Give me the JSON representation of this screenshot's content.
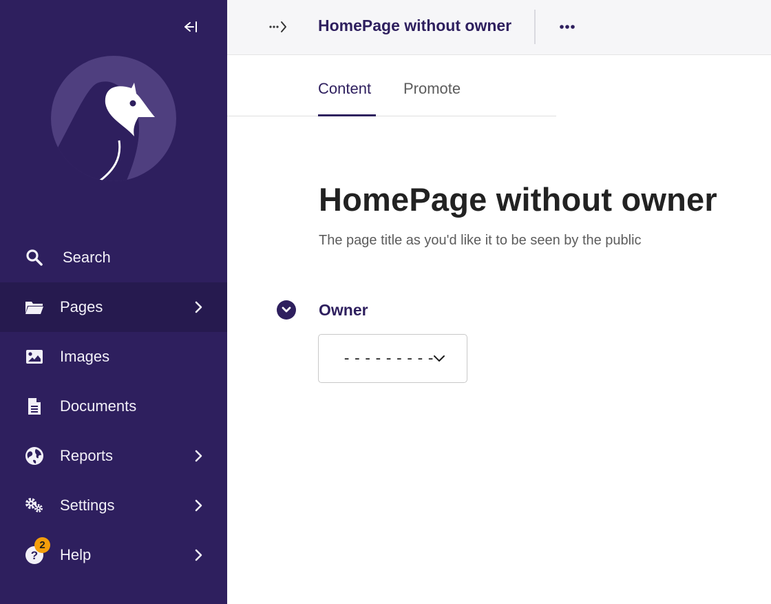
{
  "sidebar": {
    "items": [
      {
        "label": "Search",
        "icon": "search-icon"
      },
      {
        "label": "Pages",
        "icon": "folder-open-icon",
        "has_submenu": true,
        "active": true
      },
      {
        "label": "Images",
        "icon": "image-icon"
      },
      {
        "label": "Documents",
        "icon": "document-icon"
      },
      {
        "label": "Reports",
        "icon": "globe-icon",
        "has_submenu": true
      },
      {
        "label": "Settings",
        "icon": "cogs-icon",
        "has_submenu": true
      },
      {
        "label": "Help",
        "icon": "help-icon",
        "has_submenu": true,
        "badge": "2"
      }
    ]
  },
  "header": {
    "title": "HomePage without owner"
  },
  "tabs": [
    {
      "label": "Content",
      "active": true
    },
    {
      "label": "Promote",
      "active": false
    }
  ],
  "main": {
    "title": "HomePage without owner",
    "title_help": "The page title as you'd like it to be seen by the public",
    "owner": {
      "label": "Owner",
      "selected": "---------"
    }
  },
  "colors": {
    "sidebar_bg": "#2e1f5e",
    "sidebar_active_bg": "#261a4f",
    "accent": "#2e1f5e",
    "badge": "#f49e0b",
    "header_bg": "#f6f6f8"
  }
}
